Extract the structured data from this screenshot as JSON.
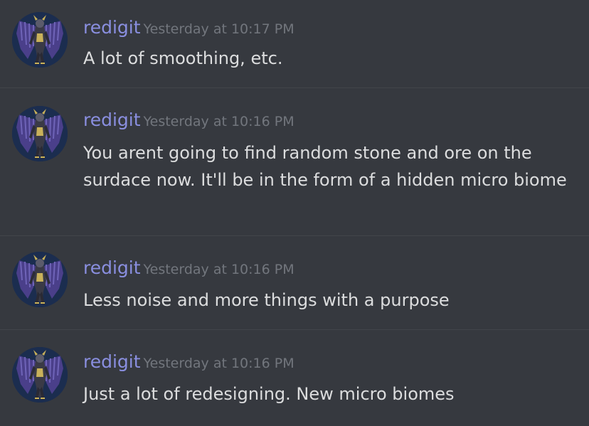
{
  "messages": [
    {
      "author": "redigit",
      "timestamp": "Yesterday at 10:17 PM",
      "text": "A lot of smoothing, etc."
    },
    {
      "author": "redigit",
      "timestamp": "Yesterday at 10:16 PM",
      "text": "You arent going to find random stone and ore on the surdace now. It'll be in the form of a hidden micro biome"
    },
    {
      "author": "redigit",
      "timestamp": "Yesterday at 10:16 PM",
      "text": "Less noise and more things with a purpose"
    },
    {
      "author": "redigit",
      "timestamp": "Yesterday at 10:16 PM",
      "text": "Just a lot of redesigning. New micro biomes"
    }
  ],
  "colors": {
    "background": "#36393f",
    "username": "#8a8fe0",
    "timestamp": "#72767d",
    "text": "#dcddde",
    "divider": "#42454a"
  },
  "icons": {
    "avatar": "winged-armored-knight-avatar-icon"
  }
}
